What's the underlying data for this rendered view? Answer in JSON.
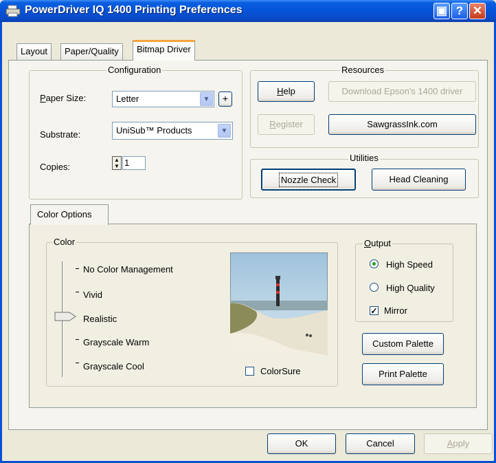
{
  "window": {
    "title": "PowerDriver IQ 1400 Printing Preferences"
  },
  "caption_buttons": {
    "context": "▣",
    "help": "?",
    "close": "✕"
  },
  "tabs": [
    {
      "label": "Layout"
    },
    {
      "label": "Paper/Quality"
    },
    {
      "label": "Bitmap Driver",
      "selected": true
    }
  ],
  "configuration": {
    "title": "Configuration",
    "paper_size_label": "Paper Size:",
    "paper_size_value": "Letter",
    "plus_label": "+",
    "substrate_label": "Substrate:",
    "substrate_value": "UniSub™ Products",
    "copies_label": "Copies:",
    "copies_value": "1"
  },
  "resources": {
    "title": "Resources",
    "help_label": "Help",
    "download_label": "Download Epson's 1400 driver",
    "register_label": "Register",
    "sawgrass_label": "SawgrassInk.com"
  },
  "utilities": {
    "title": "Utilities",
    "nozzle_label": "Nozzle Check",
    "cleaning_label": "Head Cleaning"
  },
  "color_options": {
    "tab_label": "Color Options",
    "color_group_title": "Color",
    "slider_options": [
      "No Color Management",
      "Vivid",
      "Realistic",
      "Grayscale Warm",
      "Grayscale Cool"
    ],
    "slider_selected_index": 2,
    "colorsure_label": "ColorSure",
    "colorsure_checked": false,
    "output_title": "Output",
    "high_speed_label": "High Speed",
    "high_speed_selected": true,
    "high_quality_label": "High Quality",
    "mirror_label": "Mirror",
    "mirror_checked": true,
    "custom_palette_label": "Custom Palette",
    "print_palette_label": "Print Palette"
  },
  "dialog_buttons": {
    "ok": "OK",
    "cancel": "Cancel",
    "apply": "Apply"
  },
  "colors": {
    "titlebar": "#0553d8",
    "face": "#ece9d8",
    "accent_tab": "#f7a440"
  },
  "icons": [
    "printer-icon",
    "dropdown-arrow-icon",
    "spinner-icon",
    "checkmark-icon"
  ]
}
